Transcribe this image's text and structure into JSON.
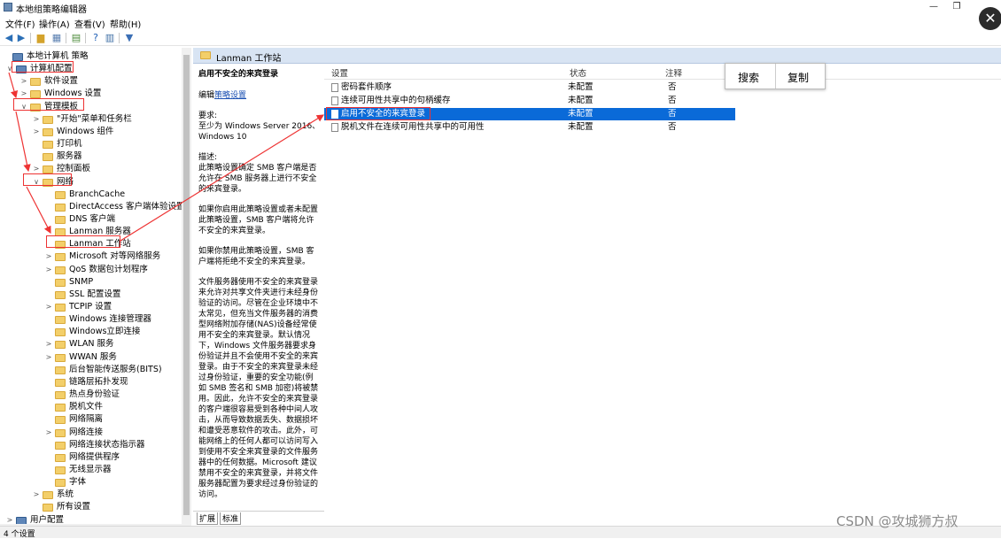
{
  "window": {
    "title": "本地组策略编辑器",
    "controls": [
      "—",
      "❐",
      "✕"
    ]
  },
  "menu": [
    "文件(F)",
    "操作(A)",
    "查看(V)",
    "帮助(H)"
  ],
  "tree": [
    {
      "label": "本地计算机 策略",
      "level": 0,
      "expander": "",
      "icon": "computer"
    },
    {
      "label": "计算机配置",
      "level": 1,
      "expander": "∨",
      "icon": "computer"
    },
    {
      "label": "软件设置",
      "level": 2,
      "expander": ">",
      "icon": "folder"
    },
    {
      "label": "Windows 设置",
      "level": 2,
      "expander": ">",
      "icon": "folder"
    },
    {
      "label": "管理模板",
      "level": 2,
      "expander": "∨",
      "icon": "folder"
    },
    {
      "label": "\"开始\"菜单和任务栏",
      "level": 3,
      "expander": ">",
      "icon": "folder"
    },
    {
      "label": "Windows 组件",
      "level": 3,
      "expander": ">",
      "icon": "folder"
    },
    {
      "label": "打印机",
      "level": 3,
      "expander": "",
      "icon": "folder"
    },
    {
      "label": "服务器",
      "level": 3,
      "expander": "",
      "icon": "folder"
    },
    {
      "label": "控制面板",
      "level": 3,
      "expander": ">",
      "icon": "folder"
    },
    {
      "label": "网络",
      "level": 3,
      "expander": "∨",
      "icon": "folder"
    },
    {
      "label": "BranchCache",
      "level": 4,
      "expander": "",
      "icon": "folder"
    },
    {
      "label": "DirectAccess 客户端体验设置",
      "level": 4,
      "expander": "",
      "icon": "folder"
    },
    {
      "label": "DNS 客户端",
      "level": 4,
      "expander": "",
      "icon": "folder"
    },
    {
      "label": "Lanman 服务器",
      "level": 4,
      "expander": "",
      "icon": "folder"
    },
    {
      "label": "Lanman 工作站",
      "level": 4,
      "expander": "",
      "icon": "folder"
    },
    {
      "label": "Microsoft 对等网络服务",
      "level": 4,
      "expander": ">",
      "icon": "folder"
    },
    {
      "label": "QoS 数据包计划程序",
      "level": 4,
      "expander": ">",
      "icon": "folder"
    },
    {
      "label": "SNMP",
      "level": 4,
      "expander": "",
      "icon": "folder"
    },
    {
      "label": "SSL 配置设置",
      "level": 4,
      "expander": "",
      "icon": "folder"
    },
    {
      "label": "TCPIP 设置",
      "level": 4,
      "expander": ">",
      "icon": "folder"
    },
    {
      "label": "Windows 连接管理器",
      "level": 4,
      "expander": "",
      "icon": "folder"
    },
    {
      "label": "Windows立即连接",
      "level": 4,
      "expander": "",
      "icon": "folder"
    },
    {
      "label": "WLAN 服务",
      "level": 4,
      "expander": ">",
      "icon": "folder"
    },
    {
      "label": "WWAN 服务",
      "level": 4,
      "expander": ">",
      "icon": "folder"
    },
    {
      "label": "后台智能传送服务(BITS)",
      "level": 4,
      "expander": "",
      "icon": "folder"
    },
    {
      "label": "链路层拓扑发现",
      "level": 4,
      "expander": "",
      "icon": "folder"
    },
    {
      "label": "热点身份验证",
      "level": 4,
      "expander": "",
      "icon": "folder"
    },
    {
      "label": "脱机文件",
      "level": 4,
      "expander": "",
      "icon": "folder"
    },
    {
      "label": "网络隔离",
      "level": 4,
      "expander": "",
      "icon": "folder"
    },
    {
      "label": "网络连接",
      "level": 4,
      "expander": ">",
      "icon": "folder"
    },
    {
      "label": "网络连接状态指示器",
      "level": 4,
      "expander": "",
      "icon": "folder"
    },
    {
      "label": "网络提供程序",
      "level": 4,
      "expander": "",
      "icon": "folder"
    },
    {
      "label": "无线显示器",
      "level": 4,
      "expander": "",
      "icon": "folder"
    },
    {
      "label": "字体",
      "level": 4,
      "expander": "",
      "icon": "folder"
    },
    {
      "label": "系统",
      "level": 3,
      "expander": ">",
      "icon": "folder"
    },
    {
      "label": "所有设置",
      "level": 3,
      "expander": "",
      "icon": "folder"
    },
    {
      "label": "用户配置",
      "level": 1,
      "expander": ">",
      "icon": "computer"
    }
  ],
  "right_header": "Lanman 工作站",
  "description": {
    "title": "启用不安全的来宾登录",
    "edit_prefix": "编辑",
    "edit_link": "策略设置",
    "req_label": "要求:",
    "req_text": "至少为 Windows Server 2016、Windows 10",
    "desc_label": "描述:",
    "p1": "此策略设置确定 SMB 客户端是否允许在 SMB 服务器上进行不安全的来宾登录。",
    "p2": "如果你启用此策略设置或者未配置此策略设置，SMB 客户端将允许不安全的来宾登录。",
    "p3": "如果你禁用此策略设置，SMB 客户端将拒绝不安全的来宾登录。",
    "p4": "文件服务器使用不安全的来宾登录来允许对共享文件夹进行未经身份验证的访问。尽管在企业环境中不太常见，但充当文件服务器的消费型网络附加存储(NAS)设备经常使用不安全的来宾登录。默认情况下，Windows 文件服务器要求身份验证并且不会使用不安全的来宾登录。由于不安全的来宾登录未经过身份验证，重要的安全功能(例如 SMB 签名和 SMB 加密)将被禁用。因此，允许不安全的来宾登录的客户端很容易受到各种中间人攻击，从而导致数据丢失、数据损坏和遭受恶意软件的攻击。此外，可能网络上的任何人都可以访问写入到使用不安全来宾登录的文件服务器中的任何数据。Microsoft 建议禁用不安全的来宾登录，并将文件服务器配置为要求经过身份验证的访问。"
  },
  "list": {
    "headers": {
      "setting": "设置",
      "state": "状态",
      "comment": "注释"
    },
    "rows": [
      {
        "name": "密码套件顺序",
        "state": "未配置",
        "comment": "否",
        "selected": false
      },
      {
        "name": "连续可用性共享中的句柄缓存",
        "state": "未配置",
        "comment": "否",
        "selected": false
      },
      {
        "name": "启用不安全的来宾登录",
        "state": "未配置",
        "comment": "否",
        "selected": true
      },
      {
        "name": "脱机文件在连续可用性共享中的可用性",
        "state": "未配置",
        "comment": "否",
        "selected": false
      }
    ]
  },
  "popup": {
    "search": "搜索",
    "copy": "复制"
  },
  "tabs": [
    "扩展",
    "标准"
  ],
  "status": "4 个设置",
  "watermark": "CSDN @攻城狮方叔",
  "colors": {
    "selection": "#0a6ad8",
    "annotation": "#e33333",
    "header": "#d8e4f3"
  }
}
